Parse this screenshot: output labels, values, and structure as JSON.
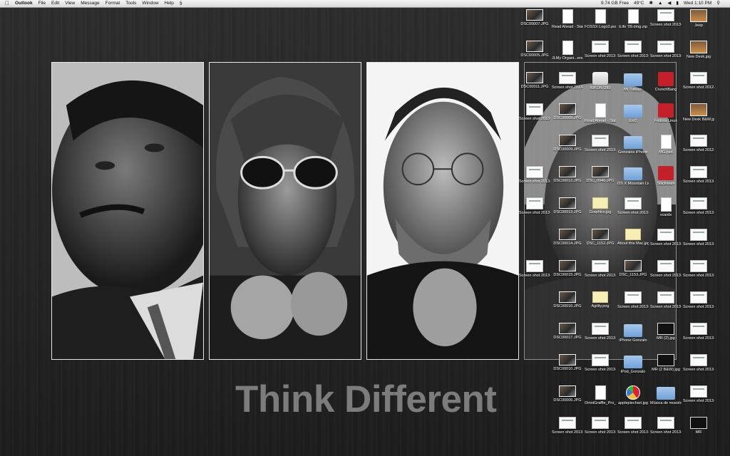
{
  "menubar": {
    "app_name": "Outlook",
    "menus": [
      "File",
      "Edit",
      "View",
      "Message",
      "Format",
      "Tools",
      "Window",
      "Help"
    ],
    "free_space": "9.74 GB Free",
    "temperature": "49°C",
    "clock": "Wed 1:10 PM"
  },
  "wallpaper": {
    "title": "Think Different"
  },
  "desktop_icons": [
    [
      "DSC00007.JPG",
      "Read Ahead - Staff C...).docx",
      "FOSSX Logo3.psd",
      "iLife '09.dmg.zip",
      "Screen shot 2013-....46 PM",
      "Jeep"
    ],
    [
      "DSC00005.JPG",
      "JLMy Organi...ers.xls",
      "Screen shot 2013-....08 AM",
      "Screen shot 2013-....28 PM",
      "Screen shot 2013-....57 PM",
      "New Desk.jpg"
    ],
    [
      "DSC00011.JPG",
      "Screen shot 2013-....40 AM",
      "NIKON D80",
      "Mi Trabajo",
      "CrunchBang",
      "Screen shot 2012-....44 PM"
    ],
    [
      "Screen shot 2013-....26 AM",
      "DSC00008.JPG",
      "Read Ahead - Staff C....docx",
      "Ext2",
      "Fedora Linux",
      "New Desk B&W.jpg"
    ],
    [
      "DSC00009.JPG",
      "Screen shot 2013-....16 PM",
      "Gonzalos iPhone",
      "MG.psd",
      "Screen shot 2012-....54 PM"
    ],
    [
      "Screen shot 2013-....30 AM",
      "DSC00012.JPG",
      "DSC_0940.JPG",
      "OS X Mountain Lion Install",
      "Slackware",
      "Screen shot 2013-....45 PM"
    ],
    [
      "Screen shot 2013-....35 AM",
      "DSC00013.JPG",
      "Graphics.jpg",
      "Screen shot 2013-....50 PM",
      "vcards",
      "Screen shot 2013-....45 PM"
    ],
    [
      "DSC00014.JPG",
      "DSC_1152.JPG",
      "About this Mac.jpg",
      "Screen shot 2013-....42 PM",
      "Screen shot 2013-....45 PM"
    ],
    [
      "Screen shot 2013-....50 AM",
      "DSC00015.JPG",
      "Screen shot 2013-....22 PM",
      "DSC_1153.JPG",
      "Screen shot 2013-....37 PM",
      "Screen shot 2013-....44 AM"
    ],
    [
      "DSC00016.JPG",
      "Agility.png",
      "Screen shot 2013-....14 PM",
      "Screen shot 2013-....55 PM",
      "Screen shot 2013-....45 PM"
    ],
    [
      "DSC00017.JPG",
      "Screen shot 2013-....50 PM",
      "iPhone Gonzalo",
      "MR (2).jpg",
      "Screen shot 2013-....30 PM"
    ],
    [
      "DSC00010.JPG",
      "Screen shot 2013-....03 PM",
      "iPod_Gonzalo",
      "MR (2 B&W).jpg",
      "Screen shot 2013-....39 PM"
    ],
    [
      "DSC00006.JPG",
      "OmniGraffle_Pro_5_...l.dmg",
      "applepiechart.jpg",
      "Música de muestra",
      "Screen shot 2013-....27 PM"
    ],
    [
      "Screen shot 2013-....48 PM",
      "Screen shot 2013-....34 PM",
      "Screen shot 2013-....31 PM",
      "Screen shot 2013-....23 PM",
      "MR"
    ]
  ]
}
